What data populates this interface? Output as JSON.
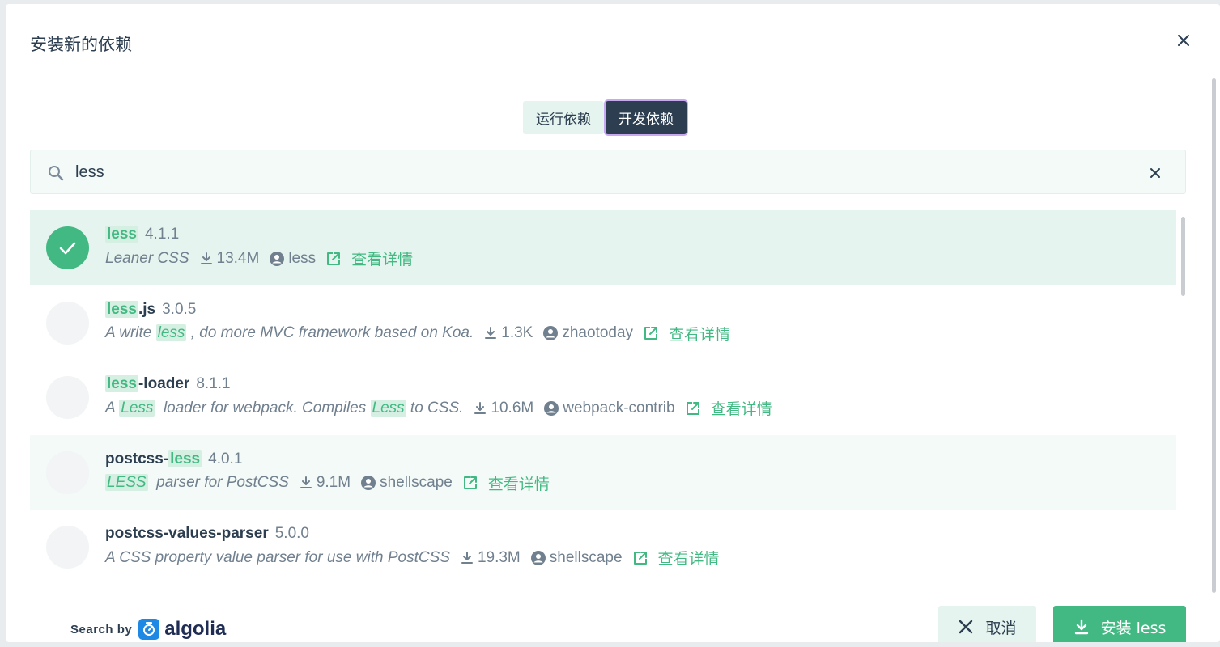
{
  "dialog": {
    "title": "安装新的依赖",
    "close_icon": "close-icon"
  },
  "tabs": [
    {
      "label": "运行依赖",
      "active": false
    },
    {
      "label": "开发依赖",
      "active": true
    }
  ],
  "search": {
    "value": "less",
    "placeholder": "",
    "icon": "search-icon",
    "clear_icon": "clear-icon"
  },
  "results": [
    {
      "name_parts": [
        {
          "t": "less",
          "hl": true
        }
      ],
      "version": "4.1.1",
      "desc_parts": [
        {
          "t": "Leaner CSS",
          "hl": false
        }
      ],
      "downloads": "13.4M",
      "author": "less",
      "detail": "查看详情",
      "selected": true
    },
    {
      "name_parts": [
        {
          "t": "less",
          "hl": true
        },
        {
          "t": ".js",
          "hl": false
        }
      ],
      "version": "3.0.5",
      "desc_parts": [
        {
          "t": "A write ",
          "hl": false
        },
        {
          "t": "less",
          "hl": true
        },
        {
          "t": " , do more MVC framework based on Koa.",
          "hl": false
        }
      ],
      "downloads": "1.3K",
      "author": "zhaotoday",
      "detail": "查看详情",
      "selected": false
    },
    {
      "name_parts": [
        {
          "t": "less",
          "hl": true
        },
        {
          "t": "-loader",
          "hl": false
        }
      ],
      "version": "8.1.1",
      "desc_parts": [
        {
          "t": "A ",
          "hl": false
        },
        {
          "t": "Less",
          "hl": true
        },
        {
          "t": "  loader for webpack. Compiles ",
          "hl": false
        },
        {
          "t": "Less",
          "hl": true
        },
        {
          "t": " to CSS.",
          "hl": false
        }
      ],
      "downloads": "10.6M",
      "author": "webpack-contrib",
      "detail": "查看详情",
      "selected": false
    },
    {
      "name_parts": [
        {
          "t": "postcss-",
          "hl": false
        },
        {
          "t": "less",
          "hl": true
        }
      ],
      "version": "4.0.1",
      "desc_parts": [
        {
          "t": "LESS",
          "hl": true
        },
        {
          "t": "  parser for PostCSS",
          "hl": false
        }
      ],
      "downloads": "9.1M",
      "author": "shellscape",
      "detail": "查看详情",
      "selected": false,
      "hover": true
    },
    {
      "name_parts": [
        {
          "t": "postcss-values-parser",
          "hl": false
        }
      ],
      "version": "5.0.0",
      "desc_parts": [
        {
          "t": "A CSS property value parser for use with PostCSS",
          "hl": false
        }
      ],
      "downloads": "19.3M",
      "author": "shellscape",
      "detail": "查看详情",
      "selected": false
    }
  ],
  "footer": {
    "search_by": "Search by",
    "brand": "algolia",
    "cancel_label": "取消",
    "install_label": "安装 less"
  },
  "colors": {
    "accent": "#42b983",
    "dark": "#2c3e50",
    "muted": "#71808f"
  }
}
